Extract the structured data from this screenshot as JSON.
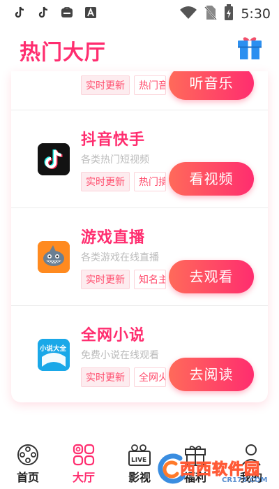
{
  "status_bar": {
    "time": "5:30",
    "left_icons": [
      "tiktok-icon",
      "tiktok-icon",
      "app-icon",
      "font-app-icon"
    ],
    "right_icons": [
      "wifi-icon",
      "no-sim-icon",
      "battery-icon"
    ]
  },
  "header": {
    "title": "热门大厅",
    "gift_icon": "gift-icon"
  },
  "list": {
    "items": [
      {
        "title": "",
        "subtitle": "",
        "tags": [
          "实时更新",
          "热门音"
        ],
        "button": "听音乐"
      },
      {
        "title": "抖音快手",
        "subtitle": "各类热门短视频",
        "tags": [
          "实时更新",
          "热门搞"
        ],
        "button": "看视频",
        "icon": "tiktok-logo-icon"
      },
      {
        "title": "游戏直播",
        "subtitle": "各类游戏在线直播",
        "tags": [
          "实时更新",
          "知名主"
        ],
        "button": "去观看",
        "icon": "shark-live-icon"
      },
      {
        "title": "全网小说",
        "subtitle": "免费小说在线观看",
        "tags": [
          "实时更新",
          "全网火"
        ],
        "button": "去阅读",
        "icon": "novel-book-icon",
        "icon_text": "小说大全"
      }
    ]
  },
  "bottom_nav": {
    "items": [
      {
        "label": "首页",
        "icon": "film-reel-icon"
      },
      {
        "label": "大厅",
        "icon": "grid-circles-icon"
      },
      {
        "label": "影视",
        "icon": "live-tv-icon"
      },
      {
        "label": "福利",
        "icon": "gift-icon"
      },
      {
        "label": "我的",
        "icon": "person-icon"
      }
    ],
    "active_index": 1
  },
  "watermark": {
    "text": "西西软件园",
    "url": "CR173.COM"
  },
  "colors": {
    "accent": "#ff2d6f",
    "button_start": "#ff6a5a",
    "button_end": "#ff2d6f",
    "tag_bg": "#fdecef"
  }
}
